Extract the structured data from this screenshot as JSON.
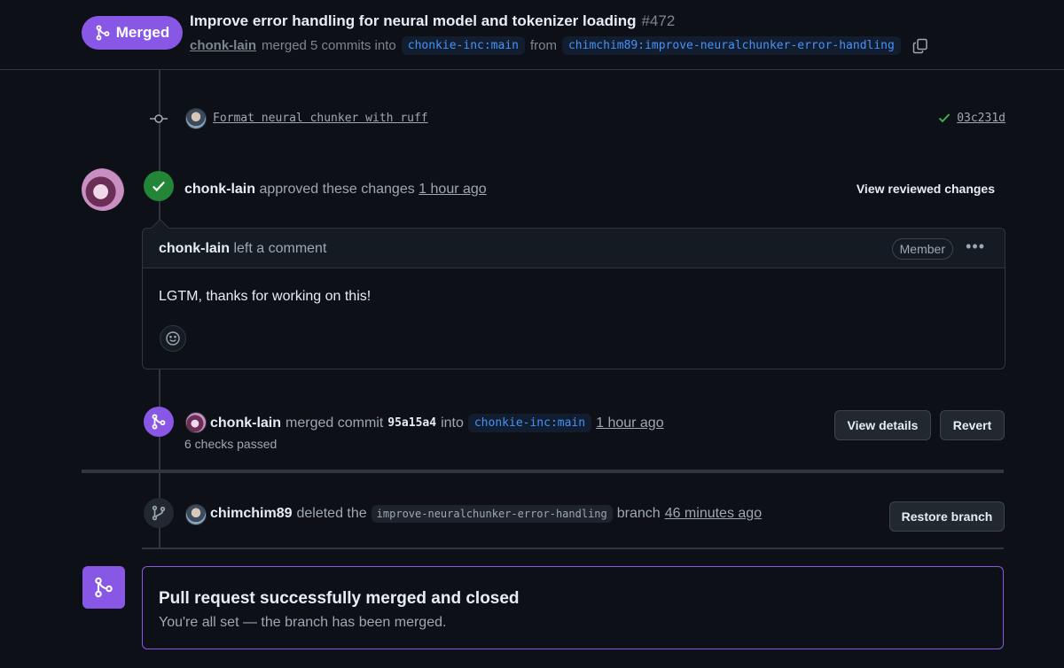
{
  "header": {
    "status": "Merged",
    "title": "Improve error handling for neural model and tokenizer loading",
    "number": "#472",
    "author": "chonk-lain",
    "merged_text": "merged 5 commits into",
    "base_branch": "chonkie-inc:main",
    "from_text": "from",
    "head_branch": "chimchim89:improve-neuralchunker-error-handling"
  },
  "commit": {
    "message": "Format neural chunker with ruff",
    "sha": "03c231d",
    "status_color": "#3fb950"
  },
  "review": {
    "author": "chonk-lain",
    "action": "approved these changes",
    "time": "1 hour ago",
    "view_label": "View reviewed changes"
  },
  "comment": {
    "author": "chonk-lain",
    "action": "left a comment",
    "role": "Member",
    "body": "LGTM, thanks for working on this!"
  },
  "merge_event": {
    "author": "chonk-lain",
    "action": "merged commit",
    "sha": "95a15a4",
    "into": "into",
    "branch": "chonkie-inc:main",
    "time": "1 hour ago",
    "checks": "6 checks passed",
    "view_details_label": "View details",
    "revert_label": "Revert"
  },
  "delete_event": {
    "author": "chimchim89",
    "action": "deleted the",
    "branch": "improve-neuralchunker-error-handling",
    "suffix": "branch",
    "time": "46 minutes ago",
    "restore_label": "Restore branch"
  },
  "merged_box": {
    "title": "Pull request successfully merged and closed",
    "subtitle": "You're all set — the branch has been merged."
  },
  "colors": {
    "merged_purple": "#8957e5",
    "approved_green": "#238636",
    "link_blue": "#4493f8",
    "background": "#0d1117"
  }
}
